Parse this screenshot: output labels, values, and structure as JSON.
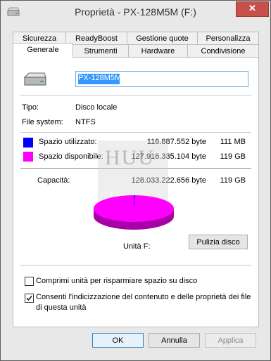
{
  "window": {
    "title": "Proprietà - PX-128M5M (F:)",
    "close_glyph": "✕"
  },
  "tabs_row1": [
    "Sicurezza",
    "ReadyBoost",
    "Gestione quote",
    "Personalizza"
  ],
  "tabs_row2": [
    "Generale",
    "Strumenti",
    "Hardware",
    "Condivisione"
  ],
  "selected_tab": "Generale",
  "general": {
    "drive_name": "PX-128M5M",
    "type_label": "Tipo:",
    "type_value": "Disco locale",
    "fs_label": "File system:",
    "fs_value": "NTFS",
    "used_label": "Spazio utilizzato:",
    "used_bytes": "116.887.552 byte",
    "used_size": "111 MB",
    "free_label": "Spazio disponibile:",
    "free_bytes": "127.916.335.104 byte",
    "free_size": "119 GB",
    "capacity_label": "Capacità:",
    "capacity_bytes": "128.033.222.656 byte",
    "capacity_size": "119 GB",
    "drive_label": "Unità F:",
    "cleanup_button": "Pulizia disco",
    "compress_label": "Comprimi unità per risparmiare spazio su disco",
    "compress_checked": false,
    "index_label_line1": "Consenti l'indicizzazione del contenuto e delle proprietà dei file",
    "index_label_line2": "di questa unità",
    "index_checked": true,
    "used_fraction": 0.001
  },
  "watermark": {
    "line1": "HUU",
    "line2": "Legend"
  },
  "colors": {
    "used": "#0000ff",
    "free": "#ff00ff",
    "close": "#c7504d"
  },
  "buttons": {
    "ok": "OK",
    "cancel": "Annulla",
    "apply": "Applica"
  }
}
